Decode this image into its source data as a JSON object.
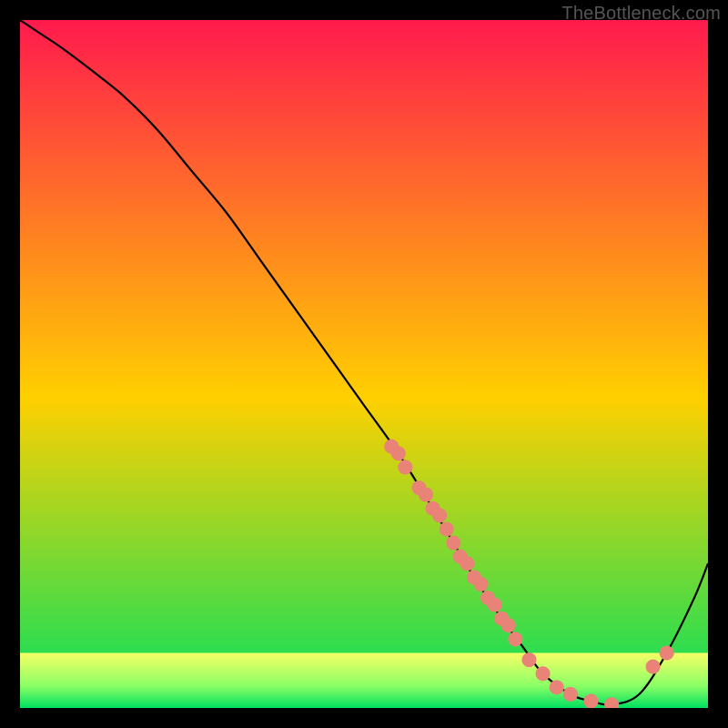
{
  "watermark": "TheBottleneck.com",
  "chart_data": {
    "type": "line",
    "title": "",
    "xlabel": "",
    "ylabel": "",
    "xlim": [
      0,
      100
    ],
    "ylim": [
      0,
      100
    ],
    "grid": false,
    "background_gradient": [
      "#ff1a4d",
      "#ffd000",
      "#00e060"
    ],
    "green_band_top_fraction": 0.92,
    "series": [
      {
        "name": "curve",
        "type": "line",
        "x": [
          0,
          3,
          6,
          10,
          15,
          20,
          25,
          30,
          35,
          40,
          45,
          50,
          55,
          60,
          63,
          66,
          70,
          73,
          76,
          80,
          83,
          86,
          90,
          94,
          98,
          100
        ],
        "y": [
          100,
          98,
          96,
          93,
          89,
          84,
          78,
          72,
          65,
          58,
          51,
          44,
          37,
          29,
          24,
          19,
          13,
          9,
          5,
          2,
          1,
          0.5,
          2,
          8,
          16,
          21
        ]
      },
      {
        "name": "markers",
        "type": "scatter",
        "x": [
          54,
          55,
          56,
          58,
          59,
          60,
          61,
          62,
          63,
          64,
          65,
          66,
          67,
          68,
          69,
          70,
          71,
          72,
          74,
          76,
          78,
          80,
          83,
          86,
          92,
          94
        ],
        "y": [
          38,
          37,
          35,
          32,
          31,
          29,
          28,
          26,
          24,
          22,
          21,
          19,
          18,
          16,
          15,
          13,
          12,
          10,
          7,
          5,
          3,
          2,
          1,
          0.5,
          6,
          8
        ],
        "marker_color": "#e98277",
        "marker_radius": 8
      }
    ]
  }
}
